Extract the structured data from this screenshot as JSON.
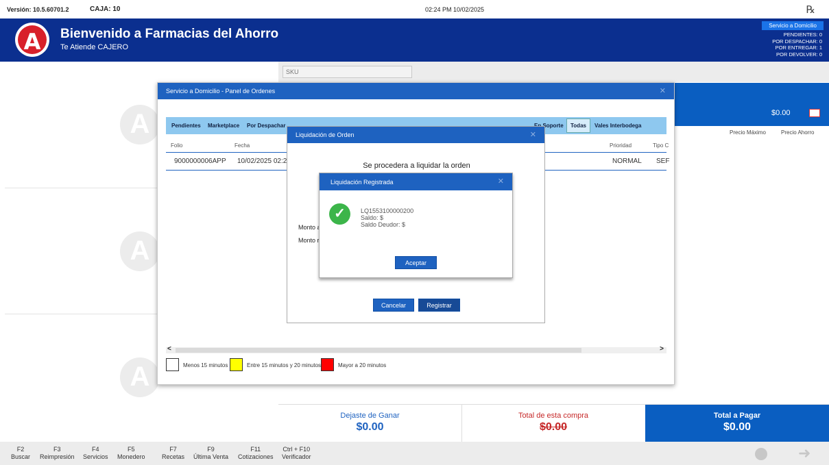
{
  "topbar": {
    "version": "Versión: 10.5.60701.2",
    "caja": "CAJA: 10",
    "datetime": "02:24 PM 10/02/2025",
    "rx_icon": "Rx"
  },
  "header": {
    "logo_letter": "A",
    "title": "Bienvenido a Farmacias del Ahorro",
    "subtitle": "Te Atiende CAJERO",
    "service_button": "Servicio a Domicilio",
    "status": {
      "pendientes": "PENDIENTES: 0",
      "por_despachar": "POR DESPACHAR: 0",
      "por_entregar": "POR ENTREGAR: 1",
      "por_devolver": "POR DEVOLVER: 0"
    }
  },
  "search": {
    "placeholder": "SKU"
  },
  "price_panel": {
    "amount": "$0.00",
    "col_max": "Precio Máximo",
    "col_ahorro": "Precio Ahorro"
  },
  "totals": {
    "dejaste_label": "Dejaste de Ganar",
    "dejaste_value": "$0.00",
    "compra_label": "Total de esta compra",
    "compra_value": "$0.00",
    "pagar_label": "Total a Pagar",
    "pagar_value": "$0.00"
  },
  "fkeys": [
    {
      "key": "F2",
      "label": "Buscar"
    },
    {
      "key": "F3",
      "label": "Reimpresión"
    },
    {
      "key": "F4",
      "label": "Servicios"
    },
    {
      "key": "F5",
      "label": "Monedero"
    },
    {
      "key": "F7",
      "label": "Recetas"
    },
    {
      "key": "F9",
      "label": "Última Venta"
    },
    {
      "key": "F11",
      "label": "Cotizaciones"
    },
    {
      "key": "Ctrl + F10",
      "label": "Verificador"
    }
  ],
  "orders_panel": {
    "title": "Servicio a Domicilio - Panel de Ordenes",
    "tabs": [
      "Pendientes",
      "Marketplace",
      "Por Despachar",
      "En Soporte",
      "Todas",
      "Vales Interbodega"
    ],
    "columns": {
      "folio": "Folio",
      "fecha": "Fecha",
      "prioridad": "Prioridad",
      "tipo": "Tipo C"
    },
    "row": {
      "folio": "9000000006APP",
      "fecha": "10/02/2025 02:2",
      "prioridad": "NORMAL",
      "tipo": "SEF"
    },
    "legend": {
      "green_label": "Menos 15 minutos",
      "yellow_label": "Entre 15 minutos y 20 minutos",
      "red_label": "Mayor a 20 minutos",
      "white_color": "#ffffff",
      "yellow_color": "#ffff00",
      "red_color": "#ff0000"
    }
  },
  "liquidacion": {
    "title": "Liquidación de Orden",
    "message": "Se procedera a liquidar la orden",
    "monto1": "Monto a",
    "monto2": "Monto r",
    "cancel": "Cancelar",
    "register": "Registrar"
  },
  "registrada": {
    "title": "Liquidación Registrada",
    "folio": "LQ1553100000200",
    "saldo": "Saldo: $",
    "saldo_deudor": "Saldo Deudor: $",
    "accept": "Aceptar"
  },
  "colors": {
    "header_bg": "#0b2f8f",
    "dialog_title": "#1e62c0",
    "total_pagar_bg": "#0a5ec1",
    "dejaste_color": "#1e62c0",
    "compra_color": "#c62828",
    "success": "#3cb54a"
  }
}
